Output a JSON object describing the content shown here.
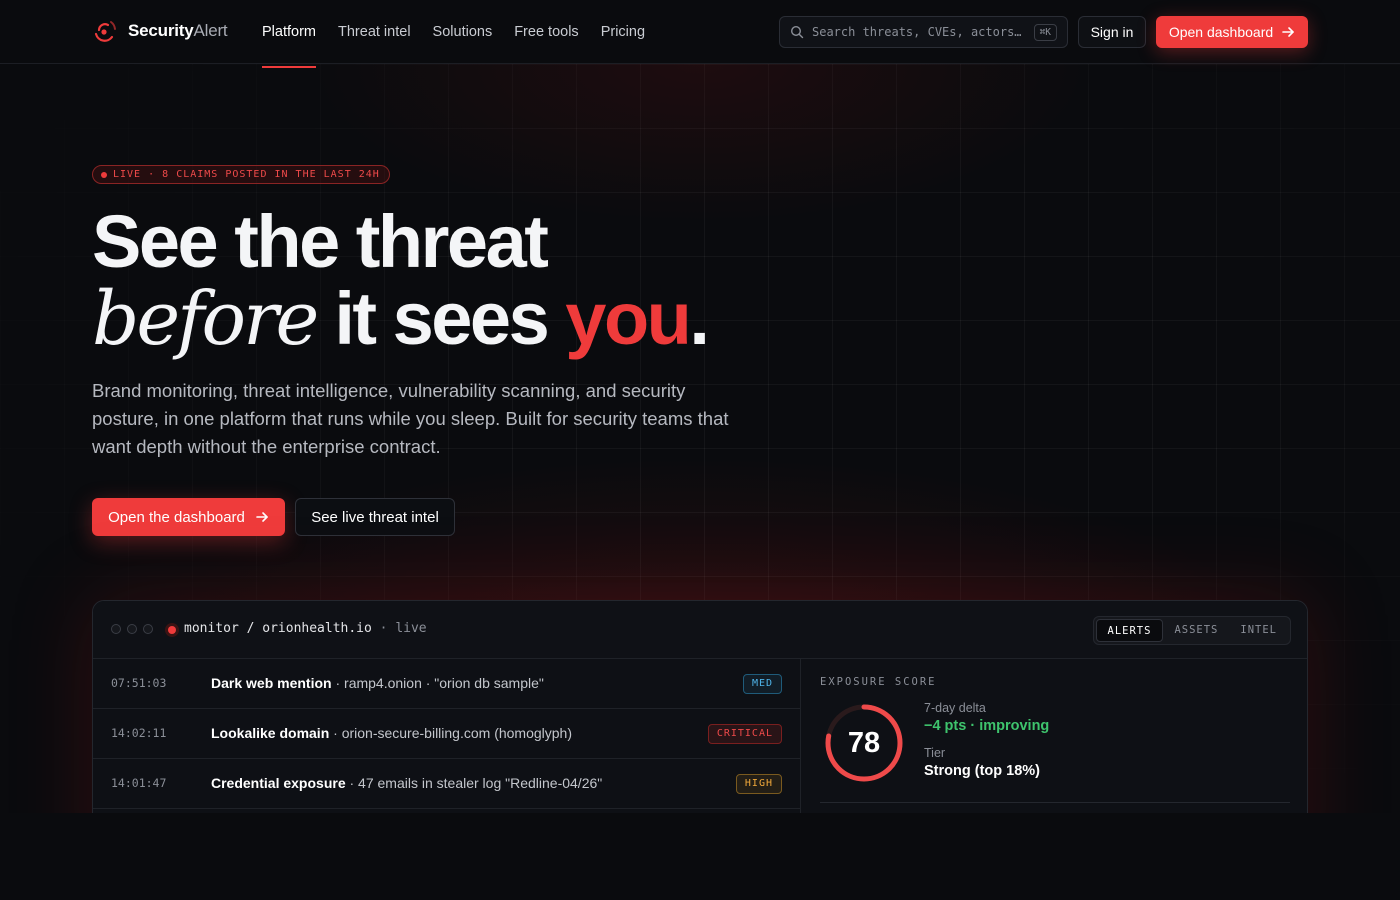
{
  "brand": {
    "name_bold": "Security",
    "name_light": "Alert"
  },
  "nav": {
    "links": [
      {
        "label": "Platform",
        "active": true
      },
      {
        "label": "Threat intel"
      },
      {
        "label": "Solutions"
      },
      {
        "label": "Free tools"
      },
      {
        "label": "Pricing"
      }
    ],
    "search_placeholder": "Search threats, CVEs, actors…",
    "search_shortcut": "⌘K",
    "signin_label": "Sign in",
    "open_dashboard_label": "Open dashboard"
  },
  "hero": {
    "live_label": "LIVE",
    "live_text": "· 8 CLAIMS POSTED IN THE LAST 24H",
    "headline_line1": "See the threat",
    "headline_italic": "before",
    "headline_mid": " it sees ",
    "headline_red": "you",
    "headline_end": ".",
    "lede": "Brand monitoring, threat intelligence, vulnerability scanning, and security posture, in one platform that runs while you sleep. Built for security teams that want depth without the enterprise contract.",
    "primary_cta": "Open the dashboard",
    "secondary_cta": "See live threat intel"
  },
  "panel": {
    "path_prefix": "monitor / orionhealth.io",
    "path_suffix": "· live",
    "tabs": [
      {
        "label": "ALERTS",
        "active": true
      },
      {
        "label": "ASSETS"
      },
      {
        "label": "INTEL"
      }
    ],
    "alerts": [
      {
        "time": "07:51:03",
        "title": "Dark web mention",
        "detail": " · ramp4.onion · \"orion db sample\"",
        "severity": "MED",
        "severity_color": "#4fb3e8"
      },
      {
        "time": "14:02:11",
        "title": "Lookalike domain",
        "detail": " · orion-secure-billing.com (homoglyph)",
        "severity": "CRITICAL",
        "severity_color": "#ef4a4a"
      },
      {
        "time": "14:01:47",
        "title": "Credential exposure",
        "detail": " · 47 emails in stealer log \"Redline-04/26\"",
        "severity": "HIGH",
        "severity_color": "#f0a83a"
      }
    ],
    "exposure": {
      "label": "EXPOSURE SCORE",
      "score": "78",
      "score_fraction": 0.78,
      "delta_label": "7-day delta",
      "delta_value": "−4 pts · improving",
      "tier_label": "Tier",
      "tier_value": "Strong (top 18%)"
    }
  },
  "colors": {
    "accent": "#ef3b3b",
    "background": "#0a0b0e",
    "positive": "#3ec46d"
  }
}
